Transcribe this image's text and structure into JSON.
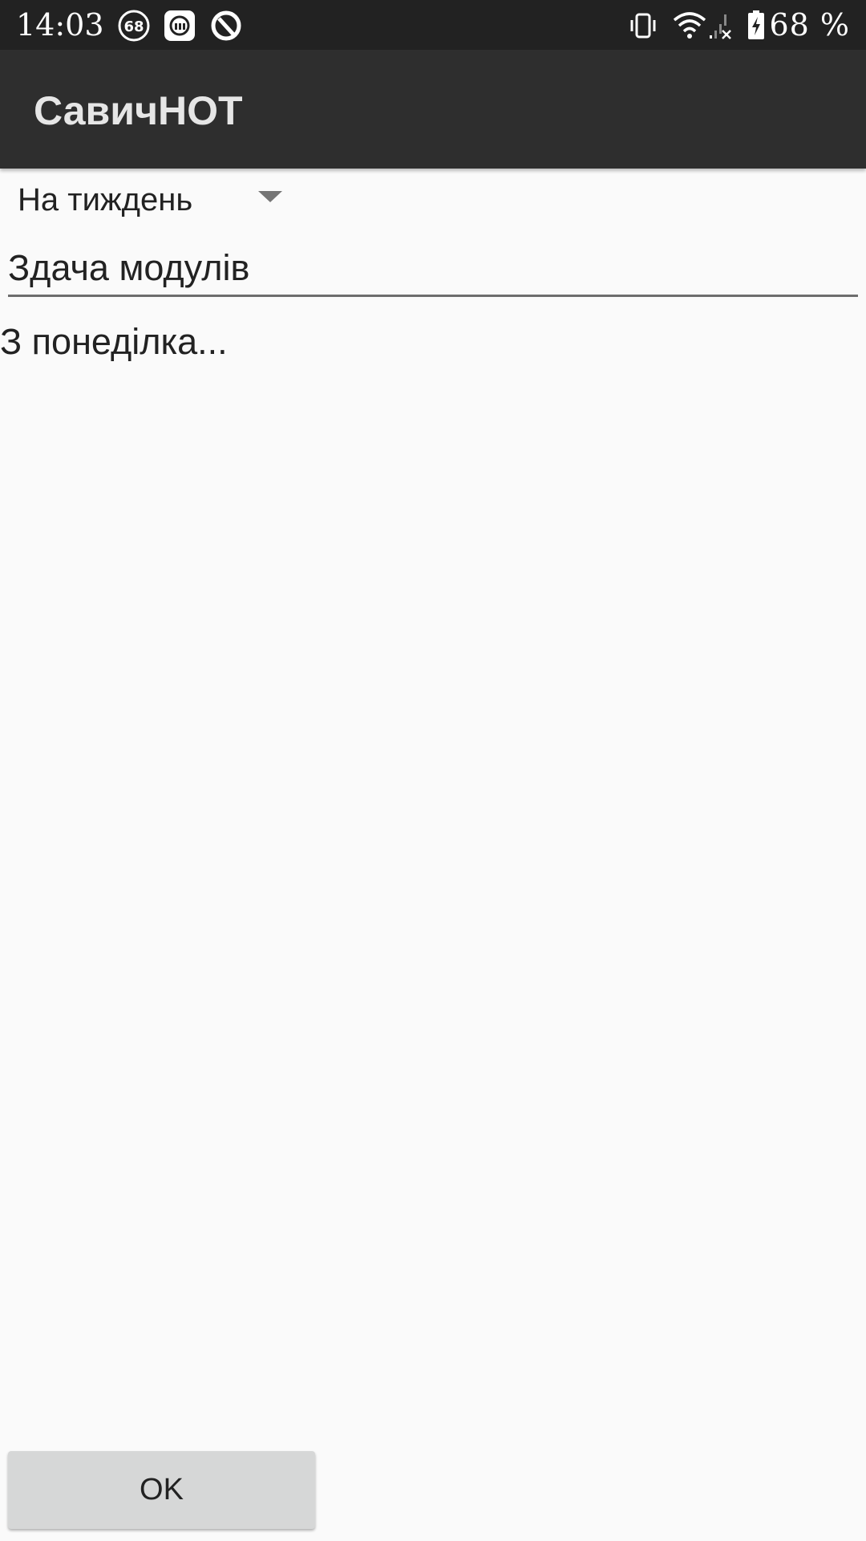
{
  "status_bar": {
    "time": "14:03",
    "notification_badge": "68",
    "battery_percent": "68 %",
    "icons": [
      "notification-count-icon",
      "mi-icon",
      "app-notification-icon",
      "vibrate-icon",
      "wifi-icon",
      "no-signal-icon",
      "battery-charging-icon"
    ]
  },
  "app_bar": {
    "title": "СавичНОТ"
  },
  "period_spinner": {
    "selected": "На тиждень"
  },
  "note": {
    "title_value": "Здача модулів",
    "body_value": "З понеділка..."
  },
  "actions": {
    "ok_label": "OK"
  }
}
